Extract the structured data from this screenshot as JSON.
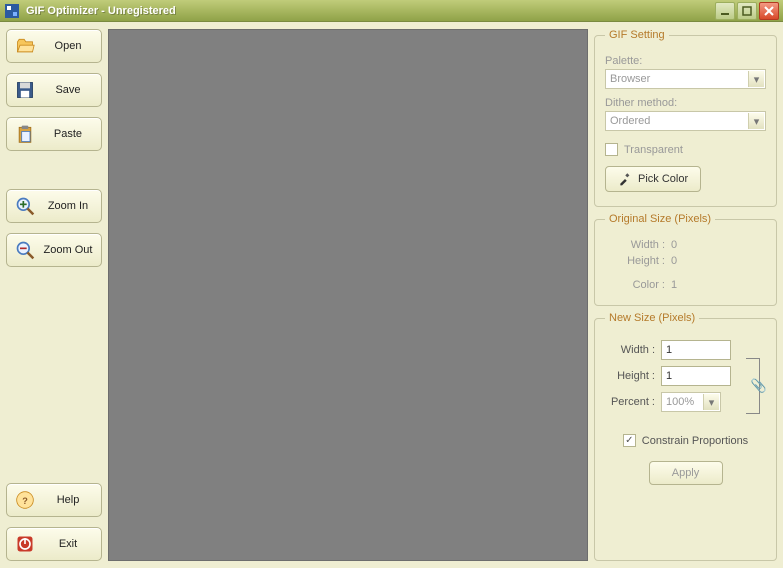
{
  "window": {
    "title": "GIF Optimizer - Unregistered"
  },
  "toolbar": {
    "open": "Open",
    "save": "Save",
    "paste": "Paste",
    "zoom_in": "Zoom In",
    "zoom_out": "Zoom Out",
    "help": "Help",
    "exit": "Exit"
  },
  "gif_setting": {
    "legend": "GIF Setting",
    "palette_label": "Palette:",
    "palette_value": "Browser",
    "dither_label": "Dither method:",
    "dither_value": "Ordered",
    "transparent_label": "Transparent",
    "transparent_checked": false,
    "pick_color": "Pick Color"
  },
  "original_size": {
    "legend": "Original Size (Pixels)",
    "width_label": "Width :",
    "width_value": "0",
    "height_label": "Height :",
    "height_value": "0",
    "color_label": "Color :",
    "color_value": "1"
  },
  "new_size": {
    "legend": "New Size (Pixels)",
    "width_label": "Width :",
    "width_value": "1",
    "height_label": "Height :",
    "height_value": "1",
    "percent_label": "Percent :",
    "percent_value": "100%",
    "constrain_label": "Constrain Proportions",
    "constrain_checked": true,
    "apply": "Apply"
  }
}
